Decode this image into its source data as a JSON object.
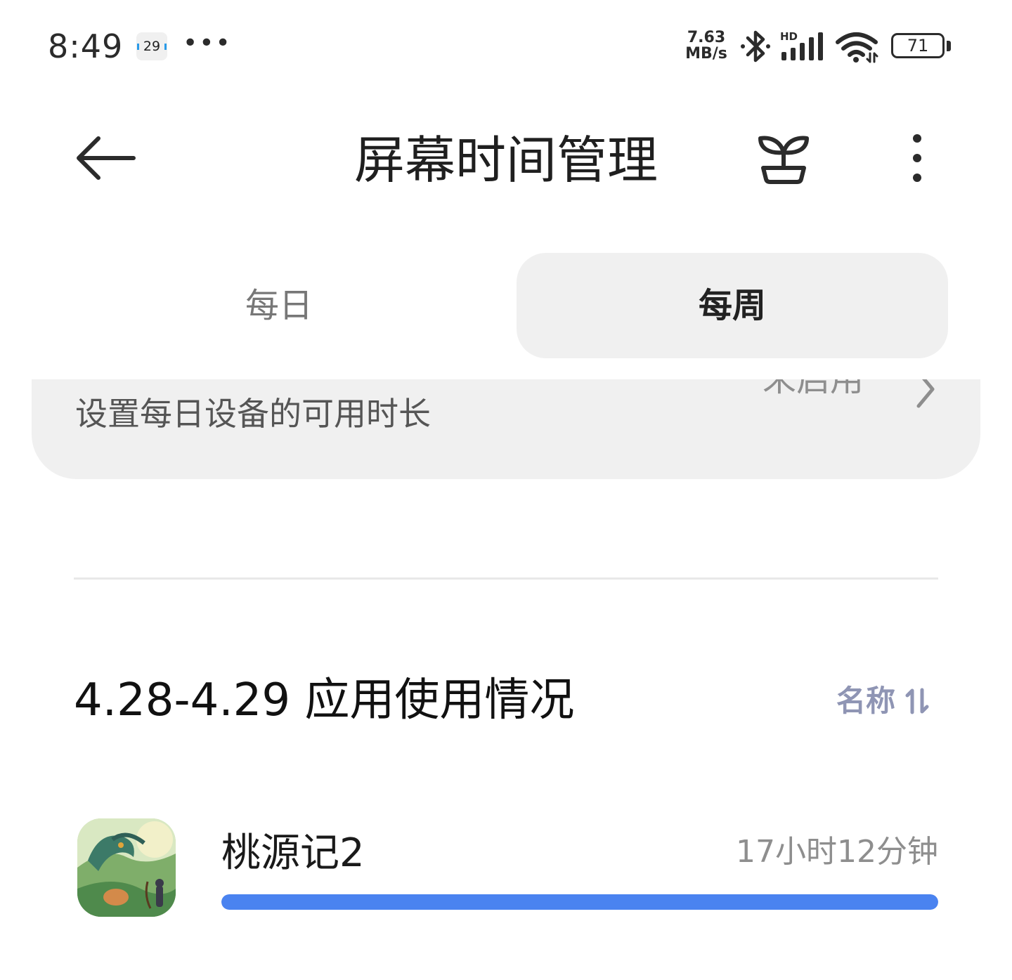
{
  "status_bar": {
    "time": "8:49",
    "notification_badge": "29",
    "more": "•••",
    "net_speed_value": "7.63",
    "net_speed_unit": "MB/s",
    "network_label": "HD",
    "battery": "71"
  },
  "header": {
    "title": "屏幕时间管理",
    "back_icon": "arrow-left-icon",
    "sprout_icon": "sprout-icon",
    "menu_icon": "more-vertical-icon"
  },
  "tabs": [
    {
      "label": "每日",
      "selected": false
    },
    {
      "label": "每周",
      "selected": true
    }
  ],
  "limit_card": {
    "status": "未启用",
    "description": "设置每日设备的可用时长"
  },
  "usage": {
    "title": "4.28-4.29 应用使用情况",
    "sort_label": "名称",
    "apps": [
      {
        "name": "桃源记2",
        "duration": "17小时12分钟",
        "usage_fraction": 1.0
      }
    ]
  },
  "colors": {
    "accent_bar": "#4a83f0",
    "sort_text": "#8f95b4",
    "tab_selected_bg": "#f0f0f0"
  }
}
